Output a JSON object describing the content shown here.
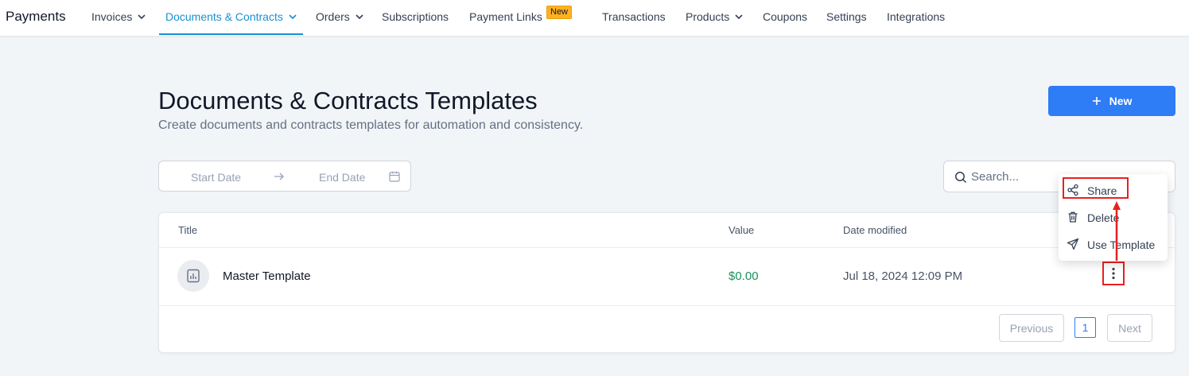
{
  "app": {
    "name": "Payments"
  },
  "nav": {
    "items": [
      {
        "label": "Invoices",
        "dropdown": true
      },
      {
        "label": "Documents & Contracts",
        "dropdown": true,
        "active": true
      },
      {
        "label": "Orders",
        "dropdown": true
      },
      {
        "label": "Subscriptions"
      },
      {
        "label": "Payment Links",
        "badge": "New"
      },
      {
        "label": "Transactions"
      },
      {
        "label": "Products",
        "dropdown": true
      },
      {
        "label": "Coupons"
      },
      {
        "label": "Settings"
      },
      {
        "label": "Integrations"
      }
    ]
  },
  "page": {
    "title": "Documents & Contracts Templates",
    "subtitle": "Create documents and contracts templates for automation and consistency.",
    "new_button": "New"
  },
  "filters": {
    "start_placeholder": "Start Date",
    "end_placeholder": "End Date",
    "search_placeholder": "Search..."
  },
  "table": {
    "columns": [
      "Title",
      "Value",
      "Date modified"
    ],
    "rows": [
      {
        "title": "Master Template",
        "value": "$0.00",
        "date_modified": "Jul 18, 2024 12:09 PM"
      }
    ]
  },
  "pagination": {
    "previous": "Previous",
    "current_page": "1",
    "next": "Next"
  },
  "menu": {
    "items": [
      "Share",
      "Delete",
      "Use Template"
    ]
  },
  "icons": {
    "chevron": "chevron-down-icon",
    "plus": "plus-icon",
    "arrow": "arrow-right-icon",
    "calendar": "calendar-icon",
    "search": "search-icon",
    "document": "document-chart-icon",
    "kebab": "more-vertical-icon",
    "share": "share-icon",
    "delete": "trash-icon",
    "use_template": "send-icon"
  },
  "colors": {
    "accent": "#1b8fd1",
    "primary_button": "#2e7cf6",
    "value_green": "#17915a",
    "badge": "#fdb022",
    "annotation": "#e8201f",
    "background": "#f2f5f7"
  }
}
